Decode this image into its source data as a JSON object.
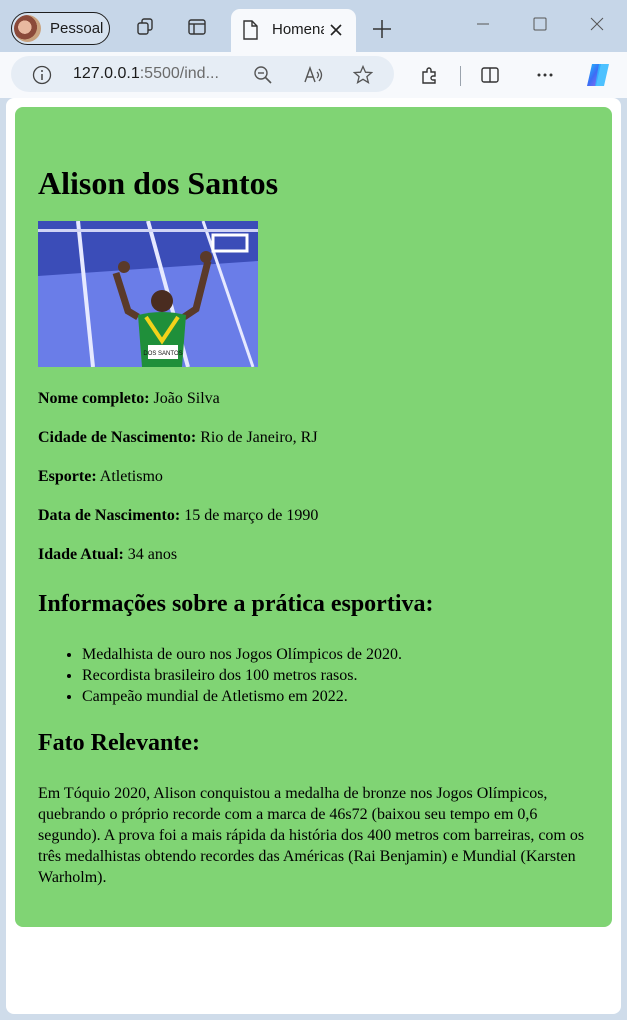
{
  "browser": {
    "profile_label": "Pessoal",
    "tab_title": "Homenagem",
    "url_host": "127.0.0.1",
    "url_rest": ":5500/ind..."
  },
  "page": {
    "title": "Alison dos Santos",
    "photo_label": "DOS SANTOS",
    "fields": [
      {
        "label": "Nome completo:",
        "value": " João Silva"
      },
      {
        "label": "Cidade de Nascimento:",
        "value": " Rio de Janeiro, RJ"
      },
      {
        "label": "Esporte:",
        "value": " Atletismo"
      },
      {
        "label": "Data de Nascimento:",
        "value": " 15 de março de 1990"
      },
      {
        "label": "Idade Atual:",
        "value": " 34 anos"
      }
    ],
    "section1_title": "Informações sobre a prática esportiva:",
    "achievements": [
      "Medalhista de ouro nos Jogos Olímpicos de 2020.",
      "Recordista brasileiro dos 100 metros rasos.",
      "Campeão mundial de Atletismo em 2022."
    ],
    "section2_title": "Fato Relevante:",
    "fact": "Em Tóquio 2020, Alison conquistou a medalha de bronze nos Jogos Olímpicos, quebrando o próprio recorde com a marca de 46s72 (baixou seu tempo em 0,6 segundo). A prova foi a mais rápida da história dos 400 metros com barreiras, com os três medalhistas obtendo recordes das Américas (Rai Benjamin) e Mundial (Karsten Warholm)."
  },
  "colors": {
    "card_background": "#80d474",
    "titlebar": "#c6d6e8"
  }
}
